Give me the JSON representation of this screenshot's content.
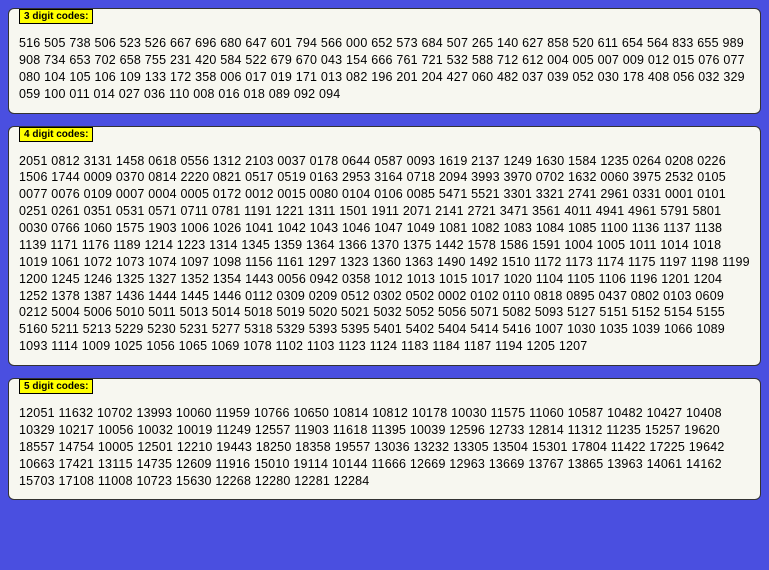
{
  "panels": [
    {
      "title": "3 digit codes:",
      "codes": [
        "516",
        "505",
        "738",
        "506",
        "523",
        "526",
        "667",
        "696",
        "680",
        "647",
        "601",
        "794",
        "566",
        "000",
        "652",
        "573",
        "684",
        "507",
        "265",
        "140",
        "627",
        "858",
        "520",
        "611",
        "654",
        "564",
        "833",
        "655",
        "989",
        "908",
        "734",
        "653",
        "702",
        "658",
        "755",
        "231",
        "420",
        "584",
        "522",
        "679",
        "670",
        "043",
        "154",
        "666",
        "761",
        "721",
        "532",
        "588",
        "712",
        "612",
        "004",
        "005",
        "007",
        "009",
        "012",
        "015",
        "076",
        "077",
        "080",
        "104",
        "105",
        "106",
        "109",
        "133",
        "172",
        "358",
        "006",
        "017",
        "019",
        "171",
        "013",
        "082",
        "196",
        "201",
        "204",
        "427",
        "060",
        "482",
        "037",
        "039",
        "052",
        "030",
        "178",
        "408",
        "056",
        "032",
        "329",
        "059",
        "100",
        "011",
        "014",
        "027",
        "036",
        "110",
        "008",
        "016",
        "018",
        "089",
        "092",
        "094"
      ]
    },
    {
      "title": "4 digit codes:",
      "codes": [
        "2051",
        "0812",
        "3131",
        "1458",
        "0618",
        "0556",
        "1312",
        "2103",
        "0037",
        "0178",
        "0644",
        "0587",
        "0093",
        "1619",
        "2137",
        "1249",
        "1630",
        "1584",
        "1235",
        "0264",
        "0208",
        "0226",
        "1506",
        "1744",
        "0009",
        "0370",
        "0814",
        "2220",
        "0821",
        "0517",
        "0519",
        "0163",
        "2953",
        "3164",
        "0718",
        "2094",
        "3993",
        "3970",
        "0702",
        "1632",
        "0060",
        "3975",
        "2532",
        "0105",
        "0077",
        "0076",
        "0109",
        "0007",
        "0004",
        "0005",
        "0172",
        "0012",
        "0015",
        "0080",
        "0104",
        "0106",
        "0085",
        "5471",
        "5521",
        "3301",
        "3321",
        "2741",
        "2961",
        "0331",
        "0001",
        "0101",
        "0251",
        "0261",
        "0351",
        "0531",
        "0571",
        "0711",
        "0781",
        "1191",
        "1221",
        "1311",
        "1501",
        "1911",
        "2071",
        "2141",
        "2721",
        "3471",
        "3561",
        "4011",
        "4941",
        "4961",
        "5791",
        "5801",
        "0030",
        "0766",
        "1060",
        "1575",
        "1903",
        "1006",
        "1026",
        "1041",
        "1042",
        "1043",
        "1046",
        "1047",
        "1049",
        "1081",
        "1082",
        "1083",
        "1084",
        "1085",
        "1100",
        "1136",
        "1137",
        "1138",
        "1139",
        "1171",
        "1176",
        "1189",
        "1214",
        "1223",
        "1314",
        "1345",
        "1359",
        "1364",
        "1366",
        "1370",
        "1375",
        "1442",
        "1578",
        "1586",
        "1591",
        "1004",
        "1005",
        "1011",
        "1014",
        "1018",
        "1019",
        "1061",
        "1072",
        "1073",
        "1074",
        "1097",
        "1098",
        "1156",
        "1161",
        "1297",
        "1323",
        "1360",
        "1363",
        "1490",
        "1492",
        "1510",
        "1172",
        "1173",
        "1174",
        "1175",
        "1197",
        "1198",
        "1199",
        "1200",
        "1245",
        "1246",
        "1325",
        "1327",
        "1352",
        "1354",
        "1443",
        "0056",
        "0942",
        "0358",
        "1012",
        "1013",
        "1015",
        "1017",
        "1020",
        "1104",
        "1105",
        "1106",
        "1196",
        "1201",
        "1204",
        "1252",
        "1378",
        "1387",
        "1436",
        "1444",
        "1445",
        "1446",
        "0112",
        "0309",
        "0209",
        "0512",
        "0302",
        "0502",
        "0002",
        "0102",
        "0110",
        "0818",
        "0895",
        "0437",
        "0802",
        "0103",
        "0609",
        "0212",
        "5004",
        "5006",
        "5010",
        "5011",
        "5013",
        "5014",
        "5018",
        "5019",
        "5020",
        "5021",
        "5032",
        "5052",
        "5056",
        "5071",
        "5082",
        "5093",
        "5127",
        "5151",
        "5152",
        "5154",
        "5155",
        "5160",
        "5211",
        "5213",
        "5229",
        "5230",
        "5231",
        "5277",
        "5318",
        "5329",
        "5393",
        "5395",
        "5401",
        "5402",
        "5404",
        "5414",
        "5416",
        "1007",
        "1030",
        "1035",
        "1039",
        "1066",
        "1089",
        "1093",
        "1114",
        "1009",
        "1025",
        "1056",
        "1065",
        "1069",
        "1078",
        "1102",
        "1103",
        "1123",
        "1124",
        "1183",
        "1184",
        "1187",
        "1194",
        "1205",
        "1207"
      ]
    },
    {
      "title": "5 digit codes:",
      "codes": [
        "12051",
        "11632",
        "10702",
        "13993",
        "10060",
        "11959",
        "10766",
        "10650",
        "10814",
        "10812",
        "10178",
        "10030",
        "11575",
        "11060",
        "10587",
        "10482",
        "10427",
        "10408",
        "10329",
        "10217",
        "10056",
        "10032",
        "10019",
        "11249",
        "12557",
        "11903",
        "11618",
        "11395",
        "10039",
        "12596",
        "12733",
        "12814",
        "11312",
        "11235",
        "15257",
        "19620",
        "18557",
        "14754",
        "10005",
        "12501",
        "12210",
        "19443",
        "18250",
        "18358",
        "19557",
        "13036",
        "13232",
        "13305",
        "13504",
        "15301",
        "17804",
        "11422",
        "17225",
        "19642",
        "10663",
        "17421",
        "13115",
        "14735",
        "12609",
        "11916",
        "15010",
        "19114",
        "10144",
        "11666",
        "12669",
        "12963",
        "13669",
        "13767",
        "13865",
        "13963",
        "14061",
        "14162",
        "15703",
        "17108",
        "11008",
        "10723",
        "15630",
        "12268",
        "12280",
        "12281",
        "12284"
      ]
    }
  ]
}
